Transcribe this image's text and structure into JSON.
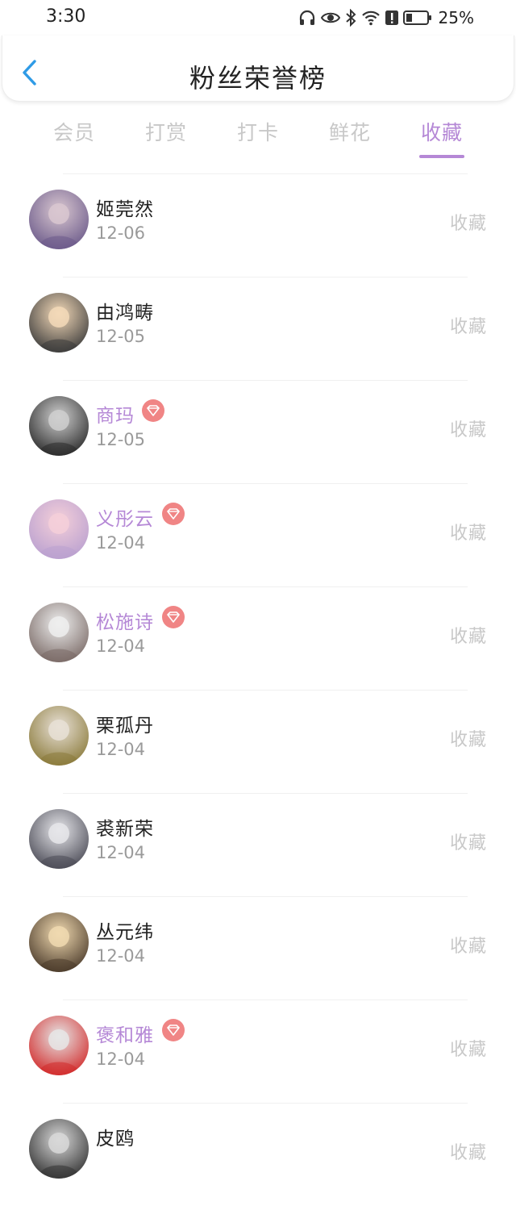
{
  "status_bar": {
    "time": "3:30",
    "battery_percent": "25%",
    "icons": [
      "headphones-icon",
      "eye-icon",
      "bluetooth-icon",
      "wifi-icon",
      "alert-icon",
      "battery-icon"
    ]
  },
  "header": {
    "title": "粉丝荣誉榜",
    "back_icon": "chevron-left-icon"
  },
  "tabs": [
    {
      "label": "会员",
      "active": false
    },
    {
      "label": "打赏",
      "active": false
    },
    {
      "label": "打卡",
      "active": false
    },
    {
      "label": "鲜花",
      "active": false
    },
    {
      "label": "收藏",
      "active": true
    }
  ],
  "colors": {
    "accent": "#b588d6",
    "vip_badge": "#f08585",
    "muted": "#c8c8c8",
    "date": "#9a9a9a"
  },
  "fans": [
    {
      "name": "姬莞然",
      "date": "12-06",
      "vip": false,
      "action": "收藏",
      "avatar_bg": [
        "#d9c7d0",
        "#6b5a8a"
      ]
    },
    {
      "name": "由鸿畴",
      "date": "12-05",
      "vip": false,
      "action": "收藏",
      "avatar_bg": [
        "#f3d9b8",
        "#3a3a3a"
      ]
    },
    {
      "name": "商玛",
      "date": "12-05",
      "vip": true,
      "action": "收藏",
      "avatar_bg": [
        "#cfcfcf",
        "#2a2a2a"
      ]
    },
    {
      "name": "义彤云",
      "date": "12-04",
      "vip": true,
      "action": "收藏",
      "avatar_bg": [
        "#f4cfd9",
        "#b9a0d0"
      ]
    },
    {
      "name": "松施诗",
      "date": "12-04",
      "vip": true,
      "action": "收藏",
      "avatar_bg": [
        "#eeeeee",
        "#7a6a66"
      ]
    },
    {
      "name": "栗孤丹",
      "date": "12-04",
      "vip": false,
      "action": "收藏",
      "avatar_bg": [
        "#e8e0d6",
        "#8a7a3a"
      ]
    },
    {
      "name": "裘新荣",
      "date": "12-04",
      "vip": false,
      "action": "收藏",
      "avatar_bg": [
        "#e6e6ea",
        "#4a4a55"
      ]
    },
    {
      "name": "丛元纬",
      "date": "12-04",
      "vip": false,
      "action": "收藏",
      "avatar_bg": [
        "#f0d9b0",
        "#4a3a2a"
      ]
    },
    {
      "name": "褒和雅",
      "date": "12-04",
      "vip": true,
      "action": "收藏",
      "avatar_bg": [
        "#e6e6e6",
        "#d22a2a"
      ]
    },
    {
      "name": "皮鸥",
      "date": "",
      "vip": false,
      "action": "收藏",
      "avatar_bg": [
        "#d8d8d8",
        "#333333"
      ]
    }
  ]
}
